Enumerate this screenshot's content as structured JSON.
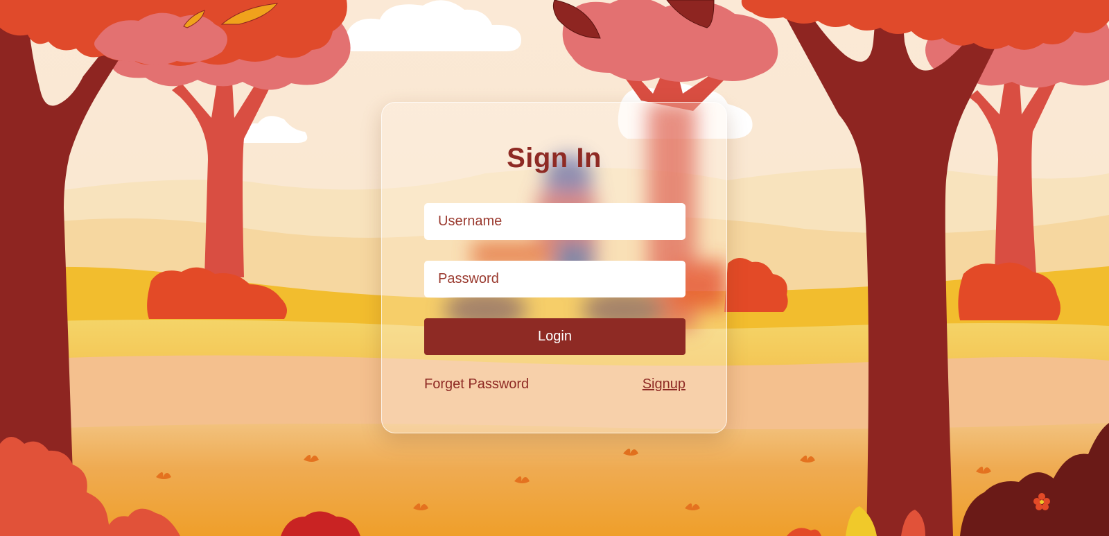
{
  "login": {
    "title": "Sign In",
    "username_placeholder": "Username",
    "password_placeholder": "Password",
    "login_label": "Login",
    "forgot_label": "Forget Password",
    "signup_label": "Signup"
  },
  "colors": {
    "primary": "#8e2a24",
    "sky": "#faeee0",
    "field": "#f3c64a",
    "ground": "#f0a43a"
  }
}
